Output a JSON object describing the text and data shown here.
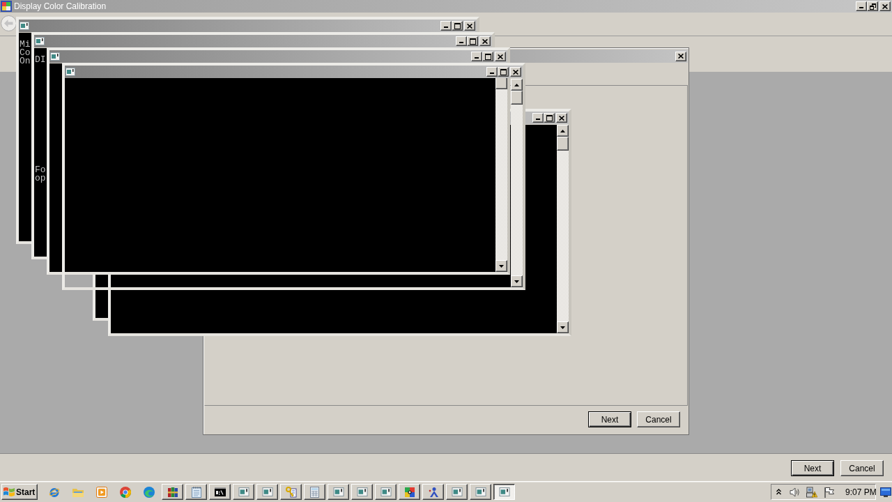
{
  "main_window": {
    "title": "Display Color Calibration",
    "back_button": {
      "disabled": true
    },
    "buttons": [
      {
        "label": "Next",
        "default": true
      },
      {
        "label": "Cancel",
        "default": false
      }
    ]
  },
  "dialog": {
    "buttons": [
      {
        "label": "Next",
        "default": true
      },
      {
        "label": "Cancel",
        "default": false
      }
    ]
  },
  "console_windows": [
    {
      "kind": "console",
      "paragraphs": [
        [
          "Mi",
          "Co",
          "On"
        ]
      ]
    },
    {
      "kind": "console",
      "paragraphs": [
        [
          "DI"
        ],
        [
          "Fo",
          "op"
        ]
      ]
    },
    {
      "kind": "console"
    },
    {
      "kind": "frame"
    },
    {
      "kind": "console"
    },
    {
      "kind": "console"
    }
  ],
  "taskbar": {
    "start": "Start",
    "tasks": [
      {
        "kind": "archive",
        "selected": false
      },
      {
        "kind": "notepad",
        "selected": false
      },
      {
        "kind": "terminal",
        "selected": false
      },
      {
        "kind": "window",
        "selected": false
      },
      {
        "kind": "window",
        "selected": false
      },
      {
        "kind": "keys",
        "selected": false
      },
      {
        "kind": "calculator",
        "selected": false
      },
      {
        "kind": "window",
        "selected": false
      },
      {
        "kind": "window",
        "selected": false
      },
      {
        "kind": "window",
        "selected": false
      },
      {
        "kind": "puzzle",
        "selected": false
      },
      {
        "kind": "figure",
        "selected": false
      },
      {
        "kind": "window",
        "selected": false
      },
      {
        "kind": "window",
        "selected": false
      },
      {
        "kind": "window",
        "selected": true
      }
    ],
    "clock": "9:07 PM"
  }
}
